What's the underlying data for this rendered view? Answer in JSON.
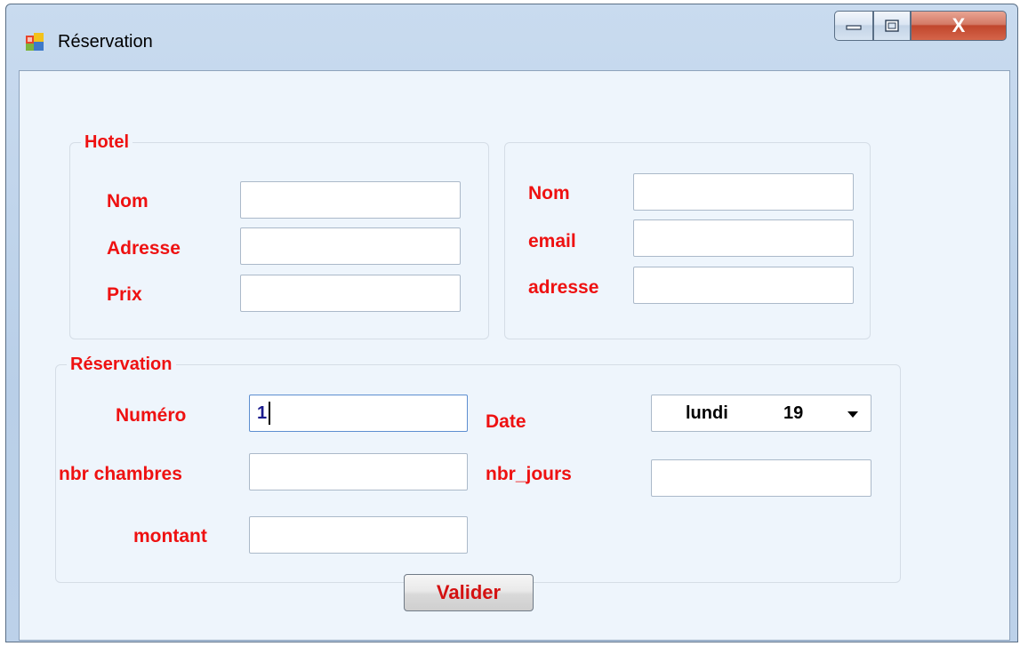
{
  "window": {
    "title": "Réservation",
    "icon": "app-window-icon",
    "close_glyph": "X"
  },
  "hotel_group": {
    "legend": "Hotel",
    "nom_label": "Nom",
    "adresse_label": "Adresse",
    "prix_label": "Prix",
    "nom_value": "",
    "adresse_value": "",
    "prix_value": ""
  },
  "client_group": {
    "nom_label": "Nom",
    "email_label": "email",
    "adresse_label": "adresse",
    "nom_value": "",
    "email_value": "",
    "adresse_value": ""
  },
  "reservation_group": {
    "legend": "Réservation",
    "numero_label": "Numéro",
    "numero_value": "1",
    "date_label": "Date",
    "date_day": "lundi",
    "date_num": "19",
    "nbr_chambres_label": "nbr chambres",
    "nbr_chambres_value": "",
    "nbr_jours_label": "nbr_jours",
    "nbr_jours_value": "",
    "montant_label": "montant",
    "montant_value": ""
  },
  "actions": {
    "valider_label": "Valider"
  },
  "colors": {
    "label_red": "#ee1111",
    "client_bg": "#eef5fc",
    "close_red": "#c0462c"
  }
}
